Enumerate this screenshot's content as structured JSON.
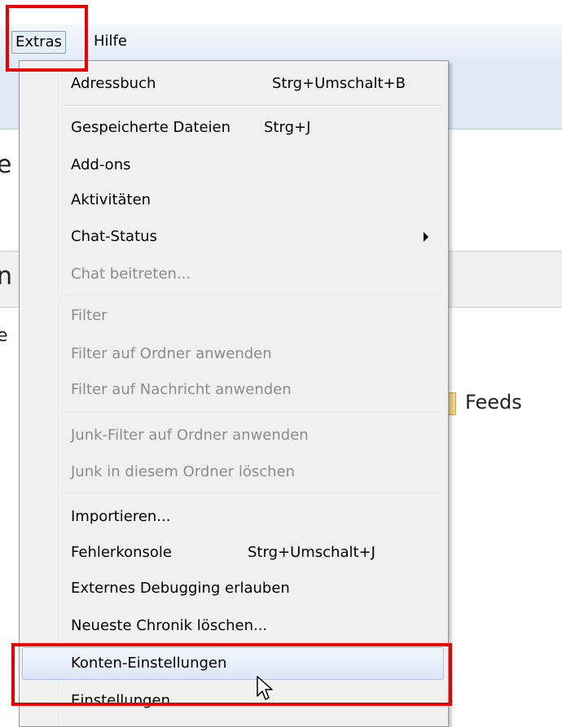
{
  "menubar": {
    "extras": "Extras",
    "hilfe": "Hilfe"
  },
  "background": {
    "feeds": "Feeds"
  },
  "menu": {
    "items": [
      {
        "label": "Adressbuch",
        "shortcut": "Strg+Umschalt+B",
        "disabled": false
      },
      {
        "label": "Gespeicherte Dateien",
        "shortcut": "Strg+J",
        "disabled": false
      },
      {
        "label": "Add-ons",
        "shortcut": "",
        "disabled": false
      },
      {
        "label": "Aktivitäten",
        "shortcut": "",
        "disabled": false
      },
      {
        "label": "Chat-Status",
        "shortcut": "",
        "disabled": false,
        "submenu": true
      },
      {
        "label": "Chat beitreten...",
        "shortcut": "",
        "disabled": true
      },
      {
        "label": "Filter",
        "shortcut": "",
        "disabled": true
      },
      {
        "label": "Filter auf Ordner anwenden",
        "shortcut": "",
        "disabled": true
      },
      {
        "label": "Filter auf Nachricht anwenden",
        "shortcut": "",
        "disabled": true
      },
      {
        "label": "Junk-Filter auf Ordner anwenden",
        "shortcut": "",
        "disabled": true
      },
      {
        "label": "Junk in diesem Ordner löschen",
        "shortcut": "",
        "disabled": true
      },
      {
        "label": "Importieren...",
        "shortcut": "",
        "disabled": false
      },
      {
        "label": "Fehlerkonsole",
        "shortcut": "Strg+Umschalt+J",
        "disabled": false
      },
      {
        "label": "Externes Debugging erlauben",
        "shortcut": "",
        "disabled": false
      },
      {
        "label": "Neueste Chronik löschen...",
        "shortcut": "",
        "disabled": false
      },
      {
        "label": "Konten-Einstellungen",
        "shortcut": "",
        "disabled": false,
        "hovered": true
      },
      {
        "label": "Einstellungen",
        "shortcut": "",
        "disabled": false
      }
    ]
  },
  "highlight_color": "#ee0000",
  "icons": {
    "submenu_arrow": "chevron-right-icon",
    "cursor": "mouse-pointer-icon"
  }
}
